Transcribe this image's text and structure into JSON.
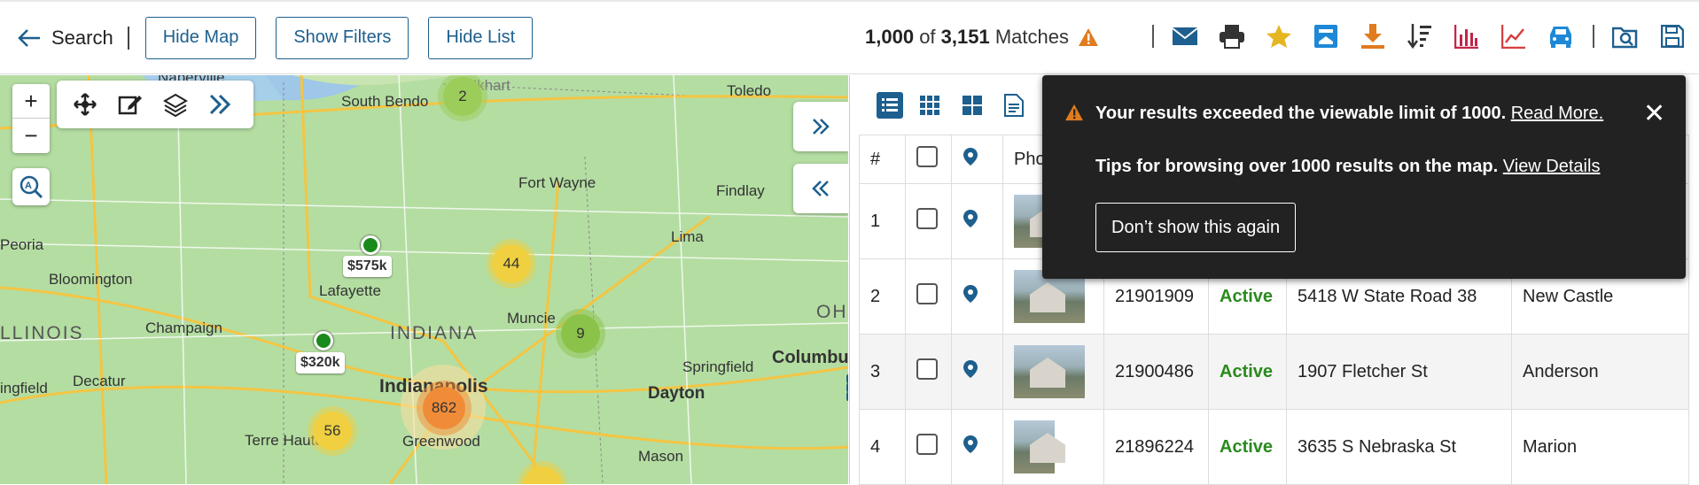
{
  "header": {
    "back_label": "Search",
    "hide_map": "Hide Map",
    "show_filters": "Show Filters",
    "hide_list": "Hide List",
    "match_shown": "1,000",
    "match_of": "of",
    "match_total": "3,151",
    "match_word": "Matches"
  },
  "toolbar_icons": [
    "email-icon",
    "print-icon",
    "star-icon",
    "export-icon",
    "download-icon",
    "sort-icon",
    "bar-chart-icon",
    "line-chart-icon",
    "car-icon",
    "search-doc-icon",
    "save-icon"
  ],
  "map": {
    "labels": {
      "naperville": "Naperville",
      "southbend": "South Bendo",
      "elkhart": "Elkhart",
      "toledo": "Toledo",
      "fortwayne": "Fort Wayne",
      "findlay": "Findlay",
      "lima": "Lima",
      "peoria": "Peoria",
      "bloomington": "Bloomington",
      "lafayette": "Lafayette",
      "illinois": "LLINOIS",
      "champaign": "Champaign",
      "indiana": "INDIANA",
      "muncie": "Muncie",
      "oh": "OH",
      "columbus": "Columbu",
      "springfield_il": "ingfield",
      "decatur": "Decatur",
      "indianapolis": "Indianapolis",
      "springfield_oh": "Springfield",
      "dayton": "Dayton",
      "terrehaute": "Terre Haute",
      "greenwood": "Greenwood",
      "mason": "Mason"
    },
    "clusters": {
      "c1": "2",
      "c2": "44",
      "c3": "862",
      "c4": "9",
      "c5": "56"
    },
    "prices": {
      "p1": "$575k",
      "p2": "$320k"
    }
  },
  "list": {
    "headers": {
      "num": "#",
      "photo": "Pho"
    },
    "rows": [
      {
        "num": "1",
        "mls": "",
        "status": "",
        "address": "",
        "city": ""
      },
      {
        "num": "2",
        "mls": "21901909",
        "status": "Active",
        "address": "5418 W State Road 38",
        "city": "New Castle"
      },
      {
        "num": "3",
        "mls": "21900486",
        "status": "Active",
        "address": "1907 Fletcher St",
        "city": "Anderson"
      },
      {
        "num": "4",
        "mls": "21896224",
        "status": "Active",
        "address": "3635 S Nebraska St",
        "city": "Marion"
      }
    ]
  },
  "toast": {
    "line1": "Your results exceeded the viewable limit of 1000.",
    "line1_link": "Read More.",
    "line2": "Tips for browsing over 1000 results on the map.",
    "line2_link": "View Details",
    "dont_show": "Don’t show this again",
    "close": "✕"
  },
  "colors": {
    "accent": "#1d5f8e",
    "active": "#2a8a1e",
    "toast_bg": "#222222"
  }
}
